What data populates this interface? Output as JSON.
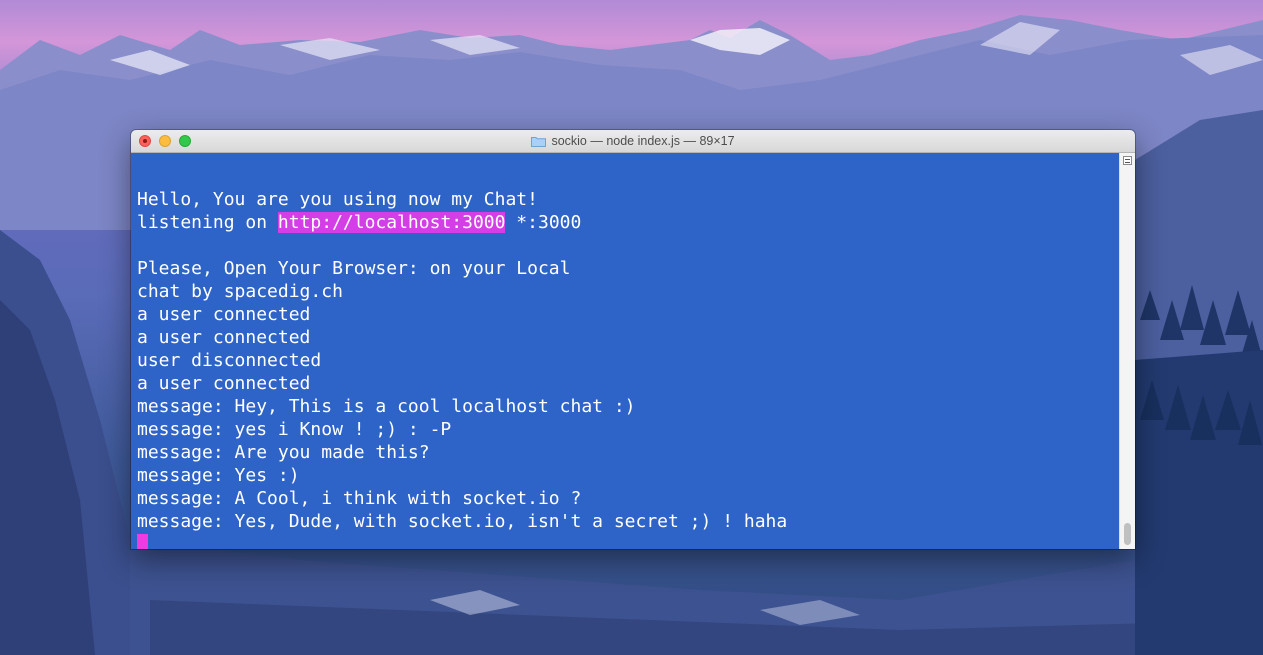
{
  "window": {
    "title": "sockio — node index.js — 89×17"
  },
  "terminal": {
    "lines": [
      {
        "text": ""
      },
      {
        "text": "Hello, You are you using now my Chat!"
      },
      {
        "prefix": "listening on ",
        "link": "http://localhost:3000",
        "suffix": " *:3000"
      },
      {
        "text": ""
      },
      {
        "text": "Please, Open Your Browser: on your Local"
      },
      {
        "text": "chat by spacedig.ch"
      },
      {
        "text": "a user connected"
      },
      {
        "text": "a user connected"
      },
      {
        "text": "user disconnected"
      },
      {
        "text": "a user connected"
      },
      {
        "text": "message: Hey, This is a cool localhost chat :)"
      },
      {
        "text": "message: yes i Know ! ;) : -P"
      },
      {
        "text": "message: Are you made this?"
      },
      {
        "text": "message: Yes :)"
      },
      {
        "text": "message: A Cool, i think with socket.io ?"
      },
      {
        "text": "message: Yes, Dude, with socket.io, isn't a secret ;) ! haha"
      }
    ]
  },
  "colors": {
    "terminal_bg": "#2e63c7",
    "terminal_fg": "#ffffff",
    "highlight": "#d43ee6",
    "cursor": "#ef3bdf"
  },
  "icons": {
    "title_icon": "folder-icon",
    "scroll_menu": "scrollbar-menu-icon"
  }
}
